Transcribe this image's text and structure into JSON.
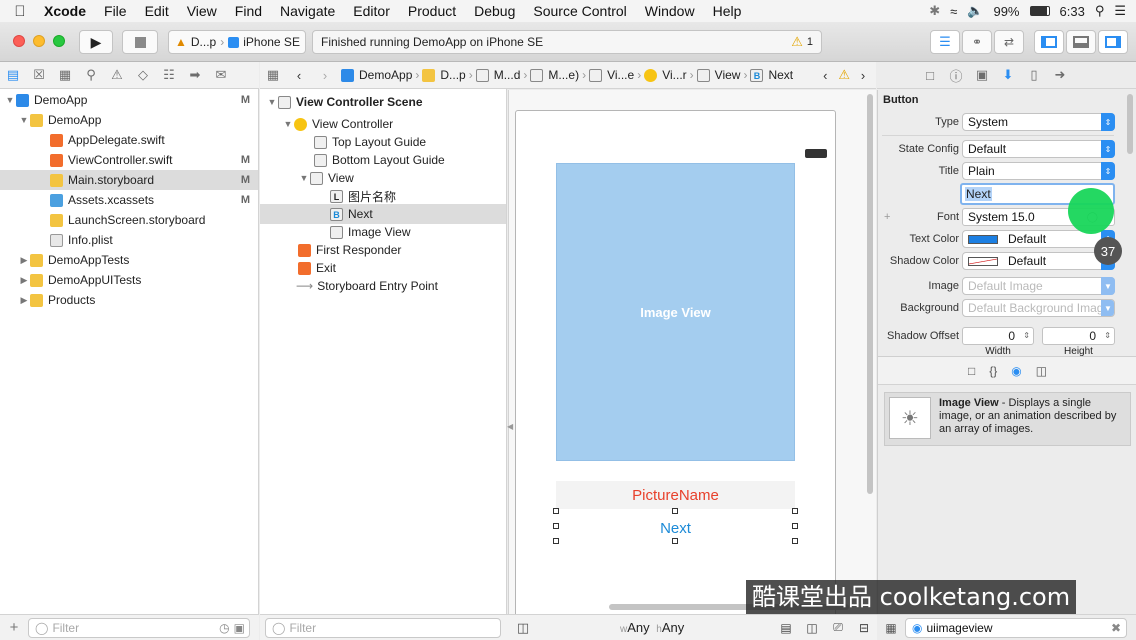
{
  "menubar": {
    "apple": "",
    "app": "Xcode",
    "items": [
      "File",
      "Edit",
      "View",
      "Find",
      "Navigate",
      "Editor",
      "Product",
      "Debug",
      "Source Control",
      "Window",
      "Help"
    ],
    "battery": "99%",
    "time": "6:33"
  },
  "toolbar": {
    "scheme_app": "D...p",
    "scheme_device": "iPhone SE",
    "activity": "Finished running DemoApp on iPhone SE",
    "warning_count": "1"
  },
  "jumpbar": {
    "items": [
      "DemoApp",
      "D...p",
      "M...d",
      "M...e)",
      "Vi...e",
      "Vi...r",
      "View",
      "Next"
    ],
    "last_badge": "B"
  },
  "navigator": {
    "project": "DemoApp",
    "project_badge": "M",
    "group": "DemoApp",
    "files": [
      {
        "name": "AppDelegate.swift",
        "badge": ""
      },
      {
        "name": "ViewController.swift",
        "badge": "M"
      },
      {
        "name": "Main.storyboard",
        "badge": "M"
      },
      {
        "name": "Assets.xcassets",
        "badge": "M"
      },
      {
        "name": "LaunchScreen.storyboard",
        "badge": ""
      },
      {
        "name": "Info.plist",
        "badge": ""
      }
    ],
    "groups": [
      "DemoAppTests",
      "DemoAppUITests",
      "Products"
    ],
    "filter_placeholder": "Filter"
  },
  "outline": {
    "scene": "View Controller Scene",
    "controller": "View Controller",
    "top_guide": "Top Layout Guide",
    "bottom_guide": "Bottom Layout Guide",
    "view": "View",
    "label": "图片名称",
    "label_badge": "L",
    "button": "Next",
    "button_badge": "B",
    "image_view": "Image View",
    "first_responder": "First Responder",
    "exit": "Exit",
    "entry_point": "Storyboard Entry Point",
    "filter_placeholder": "Filter"
  },
  "canvas": {
    "image_view_label": "Image View",
    "picture_name": "PictureName",
    "next_button": "Next",
    "size_w_prefix": "w",
    "size_w": "Any",
    "size_h_prefix": "h",
    "size_h": "Any"
  },
  "inspector": {
    "section": "Button",
    "type_label": "Type",
    "type_value": "System",
    "state_label": "State Config",
    "state_value": "Default",
    "title_label": "Title",
    "title_value": "Plain",
    "title_text": "Next",
    "font_label": "Font",
    "font_value": "System 15.0",
    "text_color_label": "Text Color",
    "text_color_value": "Default",
    "shadow_color_label": "Shadow Color",
    "shadow_color_value": "Default",
    "image_label": "Image",
    "image_placeholder": "Default Image",
    "background_label": "Background",
    "background_placeholder": "Default Background Image",
    "shadow_offset_label": "Shadow Offset",
    "shadow_w": "0",
    "shadow_h": "0",
    "width_label": "Width",
    "height_label": "Height",
    "touch_count": "37",
    "library_title": "Image View",
    "library_desc": " - Displays a single image, or an animation described by an array of images.",
    "library_search": "uiimageview"
  },
  "watermark": "酷课堂出品 coolketang.com",
  "colors": {
    "accent": "#2b8ef2",
    "image_view": "#a4cdef",
    "picture_name": "#e8412c",
    "next": "#1c8ad7",
    "touch": "#18d65a"
  }
}
